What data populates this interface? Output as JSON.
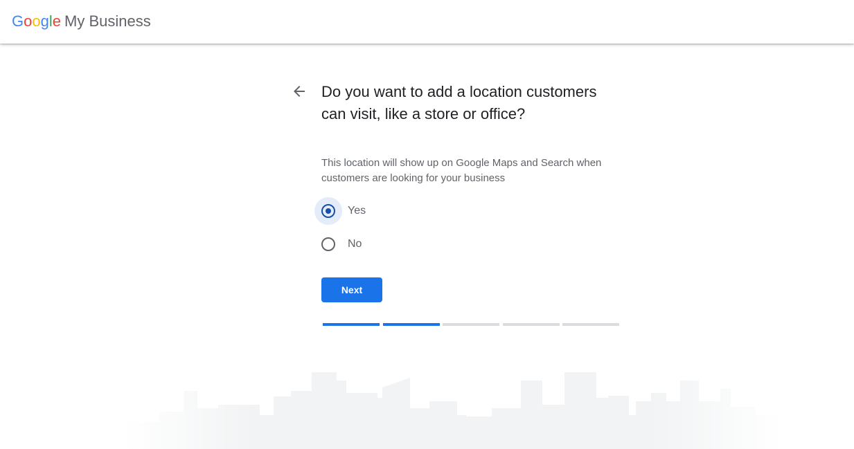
{
  "header": {
    "logo_google": [
      "G",
      "o",
      "o",
      "g",
      "l",
      "e"
    ],
    "logo_product": "My Business",
    "colors": {
      "blue": "#4285F4",
      "red": "#EA4335",
      "yellow": "#FBBC05",
      "green": "#34A853"
    }
  },
  "main": {
    "back_icon": "arrow-left-icon",
    "title": "Do you want to add a location customers can visit, like a store or office?",
    "subtitle": "This location will show up on Google Maps and Search when customers are looking for your business",
    "options": [
      {
        "label": "Yes",
        "selected": true
      },
      {
        "label": "No",
        "selected": false
      }
    ],
    "next_label": "Next",
    "accent_color": "#1a73e8"
  },
  "progress": {
    "total_steps": 5,
    "completed_steps": 2
  }
}
